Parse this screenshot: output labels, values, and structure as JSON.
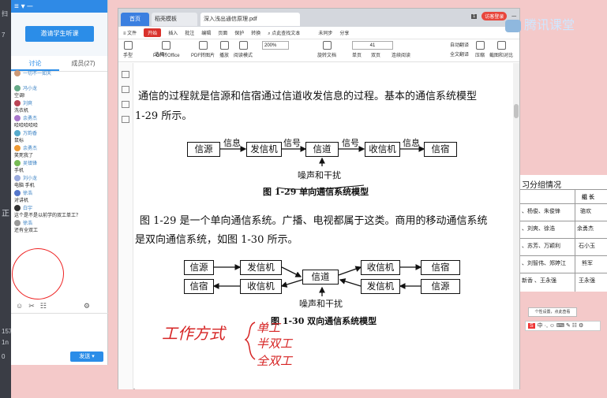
{
  "left_strip": {
    "glyphs": [
      "扫",
      "7",
      "正",
      "157",
      "1n",
      "0"
    ]
  },
  "chat": {
    "title_bar": "≡ ▾  ─",
    "invite_button": "邀请学生听课",
    "tabs": [
      {
        "label": "讨论"
      },
      {
        "label": "成员(27)"
      }
    ],
    "messages": [
      {
        "name": "一切不一如天",
        "text": ""
      },
      {
        "name": "冯小龙",
        "text": "空调!"
      },
      {
        "name": "刘爽",
        "text": "洗衣机"
      },
      {
        "name": "余勇杰",
        "text": "哈哈哈哈哈"
      },
      {
        "name": "万韵香",
        "text": "鼠标"
      },
      {
        "name": "余勇杰",
        "text": "笑死我了"
      },
      {
        "name": "吴镇锋",
        "text": "手机"
      },
      {
        "name": "刘小龙",
        "text": "电脑 手机"
      },
      {
        "name": "徐浩",
        "text": "对讲机"
      },
      {
        "name": "白宇",
        "text": "这个是不是以前学的双工单工？"
      },
      {
        "name": "徐浩",
        "text": "还有全双工"
      }
    ],
    "tools": [
      "☺",
      "✂",
      "☷",
      "⚙"
    ],
    "send_button": "发送 ▾"
  },
  "pdf": {
    "tabs": {
      "home": "首页",
      "template": "稻壳模板",
      "doc": "深入浅出通信原理.pdf"
    },
    "page_badge": "1",
    "login": "访客登录",
    "menu": [
      "≡ 文件",
      "开始",
      "插入",
      "批注",
      "编辑",
      "页面",
      "保护",
      "转换",
      "⌕ 点此查找文本",
      "未同步",
      "分享"
    ],
    "start_label": "开始",
    "tools": [
      "手型",
      "选择",
      "PDF转Office",
      "PDF转图片",
      "播放",
      "阅读模式",
      "旋转文档",
      "单页",
      "双页",
      "连续阅读",
      "自动翻译",
      "全文翻译",
      "压缩",
      "截图和对比"
    ],
    "zoom": "200%",
    "page_num": "41",
    "content": {
      "para1_line1": "通信的过程就是信源和信宿通过信道收发信息的过程。基本的通信系统模型",
      "para1_line2": "1-29 所示。",
      "fig1": {
        "boxes": [
          "信源",
          "发信机",
          "信道",
          "收信机",
          "信宿"
        ],
        "labels": [
          "信息",
          "信号",
          "信号",
          "信息"
        ],
        "noise": "噪声和干扰",
        "caption": "图 1-29   单向通信系统模型"
      },
      "para2_line1": "图 1-29 是一个单向通信系统。广播、电视都属于这类。商用的移动通信系统",
      "para2_line2": "是双向通信系统，如图 1-30 所示。",
      "fig2": {
        "top_row": [
          "信源",
          "发信机",
          "收信机",
          "信宿"
        ],
        "bottom_row": [
          "信宿",
          "收信机",
          "发信机",
          "信源"
        ],
        "channel": "信道",
        "noise": "噪声和干扰",
        "caption": "图 1-30   双向通信系统模型"
      },
      "handwriting": {
        "left": "工作方式",
        "items": [
          "单工",
          "半双工",
          "全双工"
        ]
      }
    }
  },
  "slide": {
    "title": "习分组情况",
    "header": "组 长",
    "rows": [
      {
        "members": "、杨俊、朱俊锋",
        "leader": "骆欢"
      },
      {
        "members": "、刘爽、徐浩",
        "leader": "余勇杰"
      },
      {
        "members": "、苏芳、万颖利",
        "leader": "石小玉"
      },
      {
        "members": "、刘智伟、郑婷江",
        "leader": "熊军"
      },
      {
        "members": "新香 、王永强",
        "leader": "王永强"
      }
    ]
  },
  "overlay": {
    "brand": "腾讯课堂",
    "tips": "个性设置，点此查看",
    "ime": "中 ·, ☺ ⌨ ✎ ☷ ⚙"
  }
}
